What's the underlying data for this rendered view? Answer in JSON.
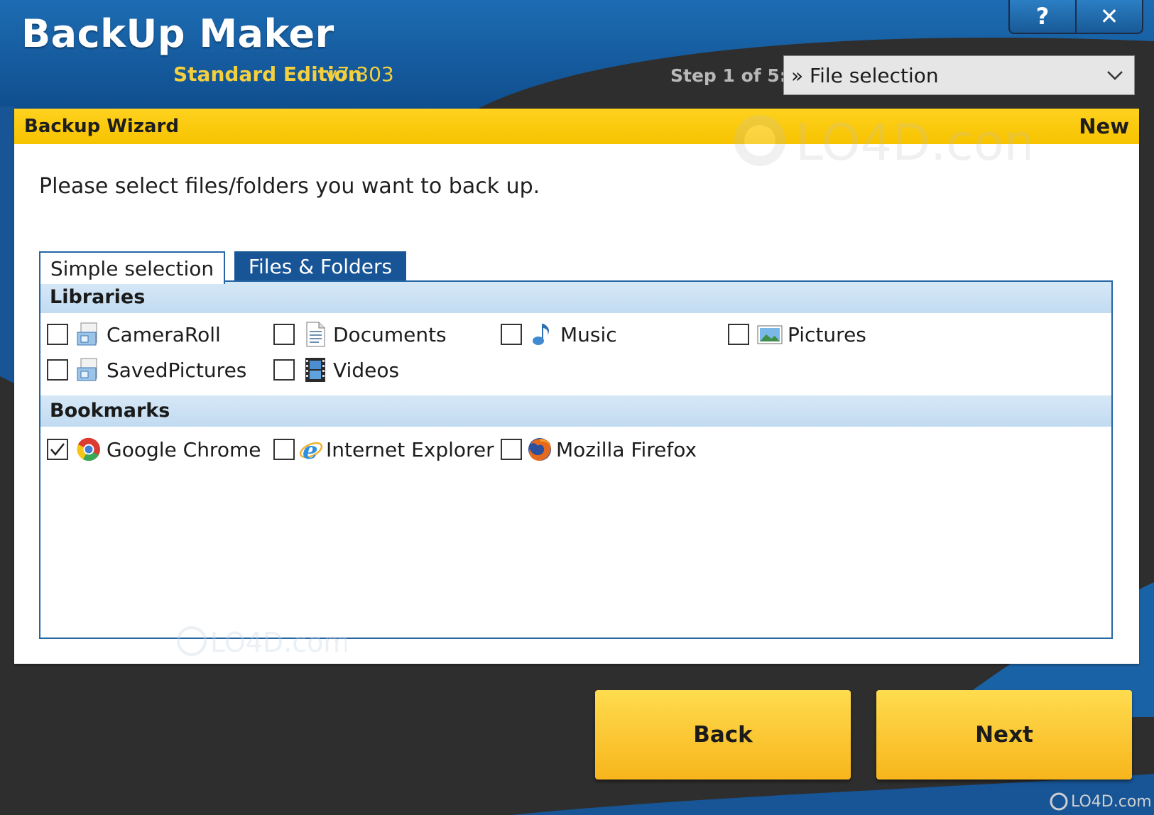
{
  "app": {
    "title": "BackUp Maker",
    "edition": "Standard Edition",
    "version": "v7.303"
  },
  "window_buttons": {
    "help": "?",
    "close": "✕"
  },
  "step": {
    "label": "Step 1 of 5:",
    "selected": "» File selection"
  },
  "panel": {
    "title": "Backup Wizard",
    "badge": "New",
    "instruction": "Please select files/folders you want to back up."
  },
  "tabs": [
    {
      "label": "Simple selection",
      "active": true
    },
    {
      "label": "Files & Folders",
      "active": false
    }
  ],
  "sections": {
    "libraries": {
      "label": "Libraries",
      "items": [
        {
          "label": "CameraRoll",
          "checked": false,
          "icon": "library-folder-icon"
        },
        {
          "label": "Documents",
          "checked": false,
          "icon": "document-icon"
        },
        {
          "label": "Music",
          "checked": false,
          "icon": "music-note-icon"
        },
        {
          "label": "Pictures",
          "checked": false,
          "icon": "picture-icon"
        },
        {
          "label": "SavedPictures",
          "checked": false,
          "icon": "library-folder-icon"
        },
        {
          "label": "Videos",
          "checked": false,
          "icon": "film-icon"
        }
      ]
    },
    "bookmarks": {
      "label": "Bookmarks",
      "items": [
        {
          "label": "Google Chrome",
          "checked": true,
          "icon": "chrome-icon"
        },
        {
          "label": "Internet Explorer",
          "checked": false,
          "icon": "internet-explorer-icon"
        },
        {
          "label": "Mozilla Firefox",
          "checked": false,
          "icon": "firefox-icon"
        }
      ]
    }
  },
  "buttons": {
    "back": "Back",
    "next": "Next"
  },
  "watermarks": {
    "main": "LO4D.com",
    "corner": "LO4D.com"
  },
  "colors": {
    "accent_blue": "#175596",
    "header_yellow": "#f7c300",
    "edition_text": "#f4cf3e"
  }
}
